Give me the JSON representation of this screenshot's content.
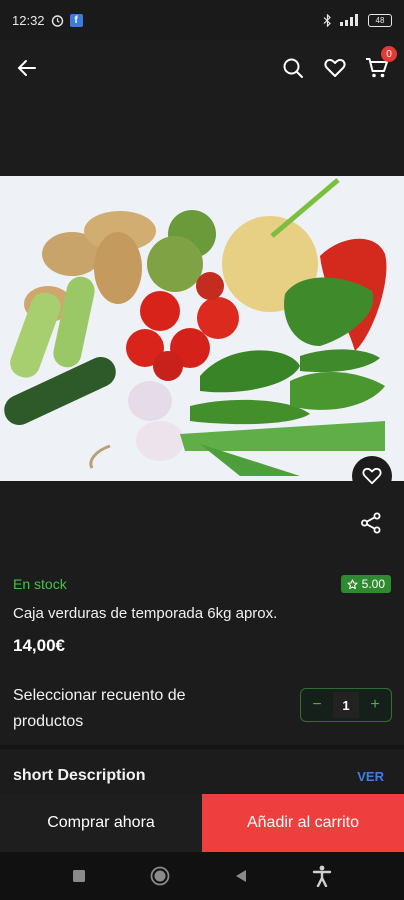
{
  "status_bar": {
    "time": "12:32",
    "battery": "48"
  },
  "app_bar": {
    "cart_count": "0"
  },
  "product": {
    "stock_status": "En stock",
    "rating": "5.00",
    "title": "Caja verduras de temporada 6kg aprox.",
    "price": "14,00€"
  },
  "quantity": {
    "label": "Seleccionar recuento de productos",
    "value": "1",
    "minus": "−",
    "plus": "+"
  },
  "description": {
    "title": "short Description",
    "link": "VER"
  },
  "actions": {
    "buy_now": "Comprar ahora",
    "add_to_cart": "Añadir al carrito"
  },
  "icons": {
    "back": "arrow-left-icon",
    "search": "search-icon",
    "favorite": "heart-icon",
    "cart": "cart-icon",
    "share": "share-icon",
    "star": "star-icon"
  },
  "colors": {
    "accent_green": "#44c247",
    "add_to_cart_bg": "#ef3e3e",
    "link_blue": "#3f7fe0"
  }
}
